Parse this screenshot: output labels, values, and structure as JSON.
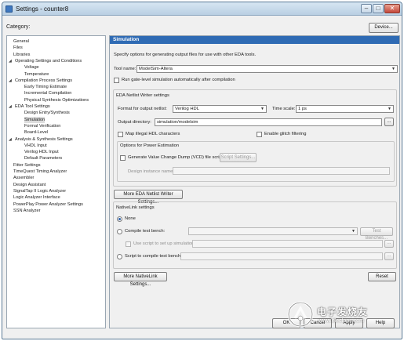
{
  "window": {
    "title": "Settings - counter8"
  },
  "header": {
    "category_label": "Category:",
    "device_button": "Device..."
  },
  "tree": [
    {
      "label": "General"
    },
    {
      "label": "Files"
    },
    {
      "label": "Libraries"
    },
    {
      "label": "Operating Settings and Conditions",
      "expanded": true
    },
    {
      "label": "Voltage",
      "selected": false
    },
    {
      "label": "Temperature"
    },
    {
      "label": "Compilation Process Settings",
      "expanded": true
    },
    {
      "label": "Early Timing Estimate"
    },
    {
      "label": "Incremental Compilation"
    },
    {
      "label": "Physical Synthesis Optimizations"
    },
    {
      "label": "EDA Tool Settings",
      "expanded": true
    },
    {
      "label": "Design Entry/Synthesis"
    },
    {
      "label": "Simulation",
      "selected": true
    },
    {
      "label": "Formal Verification"
    },
    {
      "label": "Board-Level"
    },
    {
      "label": "Analysis & Synthesis Settings",
      "expanded": true
    },
    {
      "label": "VHDL Input"
    },
    {
      "label": "Verilog HDL Input"
    },
    {
      "label": "Default Parameters"
    },
    {
      "label": "Fitter Settings"
    },
    {
      "label": "TimeQuest Timing Analyzer"
    },
    {
      "label": "Assembler"
    },
    {
      "label": "Design Assistant"
    },
    {
      "label": "SignalTap II Logic Analyzer"
    },
    {
      "label": "Logic Analyzer Interface"
    },
    {
      "label": "PowerPlay Power Analyzer Settings"
    },
    {
      "label": "SSN Analyzer"
    }
  ],
  "panel": {
    "title": "Simulation",
    "description": "Specify options for generating output files for use with other EDA tools.",
    "tool_name_label": "Tool name:",
    "tool_name_value": "ModelSim-Altera",
    "run_gate_level": "Run gate-level simulation automatically after compilation",
    "netlist_group": "EDA Netlist Writer settings",
    "format_label": "Format for output netlist:",
    "format_value": "Verilog HDL",
    "time_scale_label": "Time scale:",
    "time_scale_value": "1 ps",
    "output_dir_label": "Output directory:",
    "output_dir_value": "simulation/modelsim",
    "browse": "...",
    "map_illegal": "Map illegal HDL characters",
    "glitch": "Enable glitch filtering",
    "power_group": "Options for Power Estimation",
    "vcd_label": "Generate Value Change Dump (VCD) file script",
    "script_settings": "Script Settings...",
    "instance_name_label": "Design instance name:",
    "more_netlist": "More EDA Netlist Writer Settings...",
    "nativelink_group": "NativeLink settings",
    "none_label": "None",
    "compile_tb_label": "Compile test bench:",
    "test_benches": "Test Benches...",
    "use_script": "Use script to set up simulation:",
    "script_compile": "Script to compile test bench:",
    "more_nativelink": "More NativeLink Settings...",
    "reset": "Reset"
  },
  "footer": {
    "ok": "OK",
    "cancel": "Cancel",
    "apply": "Apply",
    "help": "Help"
  },
  "watermark": {
    "text": "电子发烧友",
    "url": "www.elecfans.com"
  }
}
